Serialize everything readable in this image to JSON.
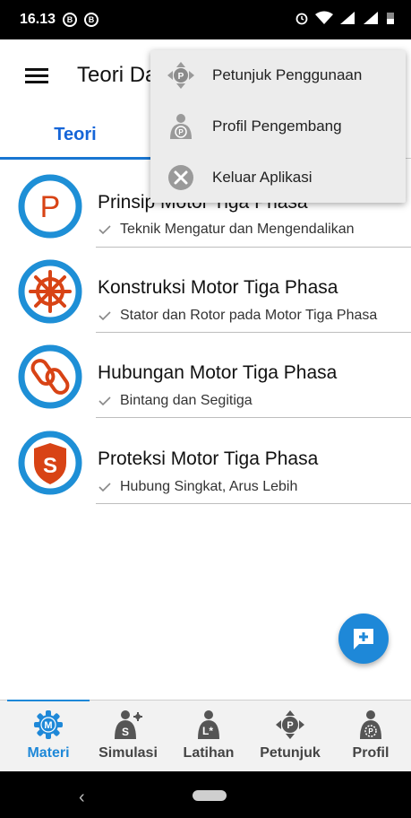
{
  "status_bar": {
    "time": "16.13",
    "badge_1": "B",
    "badge_2": "B"
  },
  "app_bar": {
    "title": "Teori Dasar"
  },
  "tabs": [
    {
      "label": "Teori",
      "selected": true
    }
  ],
  "list": {
    "items": [
      {
        "title": "Prinsip Motor Tiga Phasa",
        "subtitle": "Teknik Mengatur dan Mengendalikan",
        "icon": "p-letter-icon",
        "icon_letter": "P"
      },
      {
        "title": "Konstruksi Motor Tiga Phasa",
        "subtitle": "Stator dan Rotor pada Motor Tiga Phasa",
        "icon": "ship-wheel-icon"
      },
      {
        "title": "Hubungan Motor Tiga Phasa",
        "subtitle": "Bintang dan Segitiga",
        "icon": "chain-link-icon"
      },
      {
        "title": "Proteksi Motor Tiga Phasa",
        "subtitle": "Hubung Singkat, Arus Lebih",
        "icon": "shield-s-icon",
        "icon_letter": "S"
      }
    ]
  },
  "popup_menu": {
    "items": [
      {
        "label": "Petunjuk Penggunaan",
        "icon": "direction-pad-icon"
      },
      {
        "label": "Profil Pengembang",
        "icon": "developer-profile-icon"
      },
      {
        "label": "Keluar Aplikasi",
        "icon": "close-circle-icon"
      }
    ]
  },
  "bottom_nav": {
    "items": [
      {
        "label": "Materi",
        "icon": "materi-gear-icon",
        "active": true
      },
      {
        "label": "Simulasi",
        "icon": "simulasi-icon",
        "active": false
      },
      {
        "label": "Latihan",
        "icon": "latihan-icon",
        "active": false
      },
      {
        "label": "Petunjuk",
        "icon": "petunjuk-icon",
        "active": false
      },
      {
        "label": "Profil",
        "icon": "profil-icon",
        "active": false
      }
    ]
  },
  "colors": {
    "accent": "#1e88d8",
    "icon_ring": "#1e8fd6",
    "icon_red": "#d84315",
    "popup_bg": "#ececec"
  }
}
